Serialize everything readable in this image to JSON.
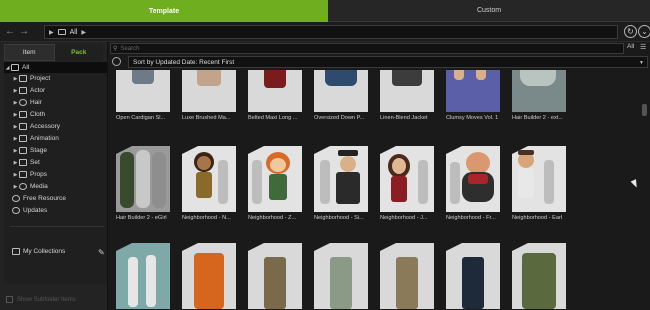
{
  "top_tabs": {
    "template": "Template",
    "custom": "Custom"
  },
  "nav": {
    "path": "All"
  },
  "left_panel": {
    "tabs": {
      "item": "Item",
      "pack": "Pack"
    },
    "tree": [
      "All",
      "Project",
      "Actor",
      "Hair",
      "Cloth",
      "Accessory",
      "Animation",
      "Stage",
      "Set",
      "Props",
      "Media",
      "Free Resource",
      "Updates",
      "My Collections"
    ],
    "show_subfolder": "Show Subfolder Items"
  },
  "search": {
    "placeholder": "Search",
    "filter": "All"
  },
  "sort": {
    "label": "Sort by Updated Date: Recent First"
  },
  "colors": {
    "accent": "#6fae1e",
    "pack_tab_text": "#7cc230"
  },
  "grid": {
    "row1": [
      "Open Cardigan Sl...",
      "Luxe Brushed Ma...",
      "Belted Maxi Long ...",
      "Oversized Down P...",
      "Linen-Blend Jacket",
      "Clumsy Moves Vol. 1",
      "Hair Builder 2 - ext..."
    ],
    "row2": [
      "Hair Builder 2 - eGirl",
      "Neighborhood - N...",
      "Neighborhood - Z...",
      "Neighborhood - Si...",
      "Neighborhood - J...",
      "Neighborhood - Fr...",
      "Neighborhood - Earl"
    ]
  }
}
